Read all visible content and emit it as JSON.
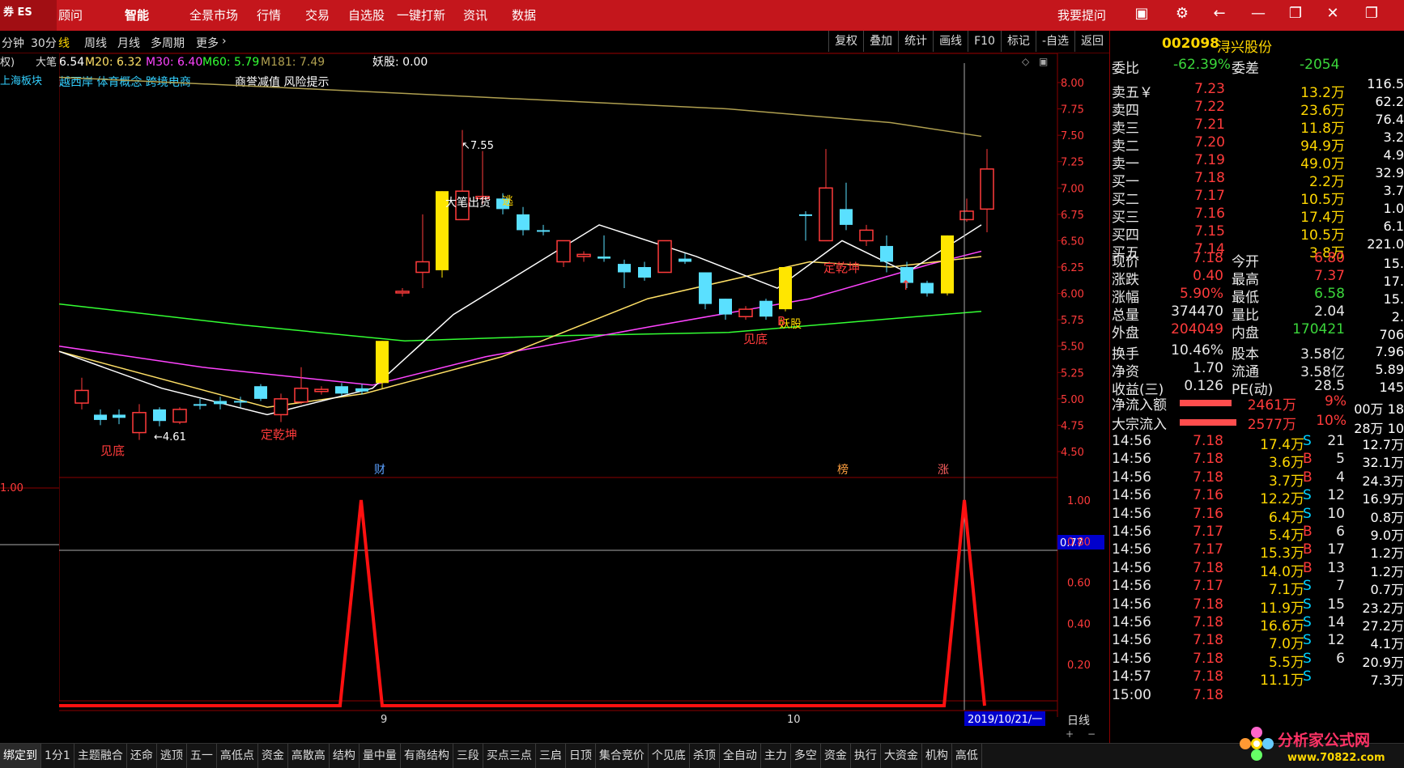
{
  "topbar": {
    "logo_text": "券\nES",
    "menu": [
      "顾问",
      "智能",
      "全景市场",
      "行情",
      "交易",
      "自选股",
      "一键打新",
      "资讯",
      "数据"
    ],
    "ask": "我要提问"
  },
  "secbar": {
    "periods": [
      "分钟",
      "30分",
      "线",
      "周线",
      "月线",
      "多周期",
      "更多"
    ],
    "tools": [
      "复权",
      "叠加",
      "统计",
      "画线",
      "F10",
      "标记",
      "-自选",
      "返回"
    ]
  },
  "indicators": {
    "ma_line": "6.54  M20: 6.32  M30: 6.40  M60: 5.79  M181: 7.49",
    "ma_prefix": "6.54",
    "m20": "M20: 6.32",
    "m30": "M30: 6.40",
    "m60": "M60: 5.79",
    "m181": "M181: 7.49",
    "yaogu": "妖股: 0.00",
    "concepts": "越西岸 体育概念 跨境电商",
    "notice": "商誉减值 风险提示",
    "sector": "上海板块",
    "left_tag": "权)",
    "left_tag2": "大笔"
  },
  "chart_data": {
    "type": "candlestick",
    "ylim": [
      4.3,
      8.3
    ],
    "yticks": [
      "8.00",
      "7.75",
      "7.50",
      "7.25",
      "7.00",
      "6.75",
      "6.50",
      "6.25",
      "6.00",
      "5.75",
      "5.50",
      "5.25",
      "5.00",
      "4.75",
      "4.50"
    ],
    "annotations": {
      "high": "7.55",
      "low": "4.61",
      "dabichu": "大笔出货",
      "tao": "逃",
      "jiandi1": "见底",
      "jiandi2": "见底",
      "dingqiankun1": "定乾坤",
      "dingqiankun2": "定乾坤",
      "yaogu": "妖股",
      "b_mark": "B",
      "cai": "财",
      "bang": "榜",
      "zhang": "涨"
    },
    "sub_yticks": [
      "1.00",
      "0.80",
      "0.60",
      "0.40",
      "0.20"
    ],
    "sub_left_label": "1.00",
    "sub_cursor_value": "0.77",
    "month_labels": [
      "9",
      "10"
    ],
    "date_label": "2019/10/21/一",
    "period_label": "日线"
  },
  "quote": {
    "code": "002098",
    "name": "浔兴股份",
    "weibi_label": "委比",
    "weibi": "-62.39%",
    "weicha_label": "委差",
    "weicha": "-2054",
    "asks": [
      {
        "label": "卖五￥",
        "price": "7.23",
        "vol": "13.2万"
      },
      {
        "label": "卖四",
        "price": "7.22",
        "vol": "23.6万"
      },
      {
        "label": "卖三",
        "price": "7.21",
        "vol": "11.8万"
      },
      {
        "label": "卖二",
        "price": "7.20",
        "vol": "94.9万"
      },
      {
        "label": "卖一",
        "price": "7.19",
        "vol": "49.0万"
      }
    ],
    "bids": [
      {
        "label": "买一",
        "price": "7.18",
        "vol": "2.2万"
      },
      {
        "label": "买二",
        "price": "7.17",
        "vol": "10.5万"
      },
      {
        "label": "买三",
        "price": "7.16",
        "vol": "17.4万"
      },
      {
        "label": "买四",
        "price": "7.15",
        "vol": "10.5万"
      },
      {
        "label": "买五",
        "price": "7.14",
        "vol": "3.8万"
      }
    ],
    "stats": [
      {
        "l1": "现价",
        "v1": "7.18",
        "l2": "今开",
        "v2": "6.80"
      },
      {
        "l1": "涨跌",
        "v1": "0.40",
        "l2": "最高",
        "v2": "7.37"
      },
      {
        "l1": "涨幅",
        "v1": "5.90%",
        "l2": "最低",
        "v2": "6.58"
      },
      {
        "l1": "总量",
        "v1": "374470",
        "l2": "量比",
        "v2": "2.04"
      },
      {
        "l1": "外盘",
        "v1": "204049",
        "l2": "内盘",
        "v2": "170421"
      },
      {
        "l1": "换手",
        "v1": "10.46%",
        "l2": "股本",
        "v2": "3.58亿"
      },
      {
        "l1": "净资",
        "v1": "1.70",
        "l2": "流通",
        "v2": "3.58亿"
      },
      {
        "l1": "收益(三)",
        "v1": "0.126",
        "l2": "PE(动)",
        "v2": "28.5"
      }
    ],
    "flows": [
      {
        "label": "净流入额",
        "val": "2461万",
        "pct": "9%"
      },
      {
        "label": "大宗流入",
        "val": "2577万",
        "pct": "10%"
      }
    ],
    "ticks": [
      {
        "t": "14:56",
        "p": "7.18",
        "v": "17.4万",
        "s": "S",
        "n": "21"
      },
      {
        "t": "14:56",
        "p": "7.18",
        "v": "3.6万",
        "s": "B",
        "n": "5"
      },
      {
        "t": "14:56",
        "p": "7.18",
        "v": "3.7万",
        "s": "B",
        "n": "4"
      },
      {
        "t": "14:56",
        "p": "7.16",
        "v": "12.2万",
        "s": "S",
        "n": "12"
      },
      {
        "t": "14:56",
        "p": "7.16",
        "v": "6.4万",
        "s": "S",
        "n": "10"
      },
      {
        "t": "14:56",
        "p": "7.17",
        "v": "5.4万",
        "s": "B",
        "n": "6"
      },
      {
        "t": "14:56",
        "p": "7.17",
        "v": "15.3万",
        "s": "B",
        "n": "17"
      },
      {
        "t": "14:56",
        "p": "7.18",
        "v": "14.0万",
        "s": "B",
        "n": "13"
      },
      {
        "t": "14:56",
        "p": "7.17",
        "v": "7.1万",
        "s": "S",
        "n": "7"
      },
      {
        "t": "14:56",
        "p": "7.18",
        "v": "11.9万",
        "s": "S",
        "n": "15"
      },
      {
        "t": "14:56",
        "p": "7.18",
        "v": "16.6万",
        "s": "S",
        "n": "14"
      },
      {
        "t": "14:56",
        "p": "7.18",
        "v": "7.0万",
        "s": "S",
        "n": "12"
      },
      {
        "t": "14:56",
        "p": "7.18",
        "v": "5.5万",
        "s": "S",
        "n": "6"
      },
      {
        "t": "14:57",
        "p": "7.18",
        "v": "11.1万",
        "s": "S",
        "n": ""
      },
      {
        "t": "15:00",
        "p": "7.18",
        "v": "",
        "s": "",
        "n": ""
      }
    ]
  },
  "far_column": [
    "116.5",
    "62.2",
    "76.4",
    "3.2",
    "4.9",
    "32.9",
    "3.7",
    "1.0",
    "6.1",
    "221.0",
    "15.",
    "17.",
    "15.",
    "2.",
    "706",
    "7.96",
    "5.89",
    "145",
    "00万 18",
    "28万 10",
    "12.7万",
    "32.1万",
    "24.3万",
    "16.9万",
    "0.8万",
    "9.0万",
    "1.2万",
    "1.2万",
    "0.7万",
    "23.2万",
    "27.2万",
    "4.1万",
    "20.9万",
    "7.3万"
  ],
  "bottom_tabs": [
    "绑定到",
    "1分1",
    "主题融合",
    "还命",
    "逃顶",
    "五一",
    "高低点",
    "资金",
    "高散高",
    "结构",
    "量中量",
    "有商结构",
    "三段",
    "买点三点",
    "三启",
    "日顶",
    "集合竞价",
    "个见底",
    "杀顶",
    "全自动",
    "主力",
    "多空",
    "资金",
    "执行",
    "大资金",
    "机构",
    "高低"
  ],
  "watermark": {
    "main": "分析家公式网",
    "url": "www.70822.com"
  }
}
